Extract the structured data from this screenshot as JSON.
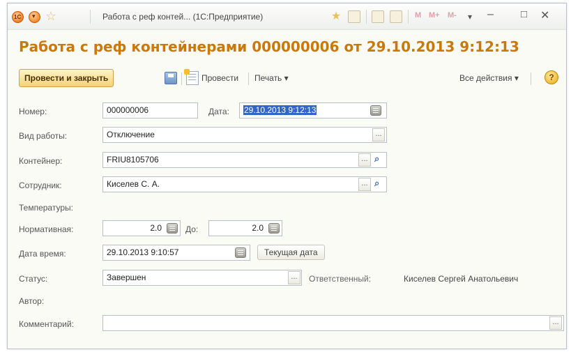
{
  "window": {
    "title": "Работа с реф контей... (1С:Предприятие)",
    "badge_logo": "1С",
    "toolbar_letters": [
      "M",
      "M+",
      "M-"
    ]
  },
  "heading": "Работа с реф контейнерами 000000006 от 29.10.2013 9:12:13",
  "toolbar": {
    "post_close_label": "Провести и закрыть",
    "post_label": "Провести",
    "print_label": "Печать",
    "all_actions_label": "Все действия",
    "help_label": "?"
  },
  "form": {
    "number_label": "Номер:",
    "number_value": "000000006",
    "date_label": "Дата:",
    "date_value": "29.10.2013 9:12:13",
    "work_type_label": "Вид работы:",
    "work_type_value": "Отключение",
    "container_label": "Контейнер:",
    "container_value": "FRIU8105706",
    "employee_label": "Сотрудник:",
    "employee_value": "Киселев С. А.",
    "temperatures_label": "Температуры:",
    "normative_label": "Нормативная:",
    "normative_value": "2.0",
    "to_label": "До:",
    "to_value": "2.0",
    "datetime_label": "Дата время:",
    "datetime_value": "29.10.2013  9:10:57",
    "current_date_button": "Текущая дата",
    "status_label": "Статус:",
    "status_value": "Завершен",
    "responsible_label": "Ответственный:",
    "responsible_value": "Киселев Сергей Анатольевич",
    "author_label": "Автор:",
    "comment_label": "Комментарий:",
    "comment_value": ""
  },
  "buttons": {
    "ellipsis": "...",
    "dropdown_arrow": "▾"
  }
}
